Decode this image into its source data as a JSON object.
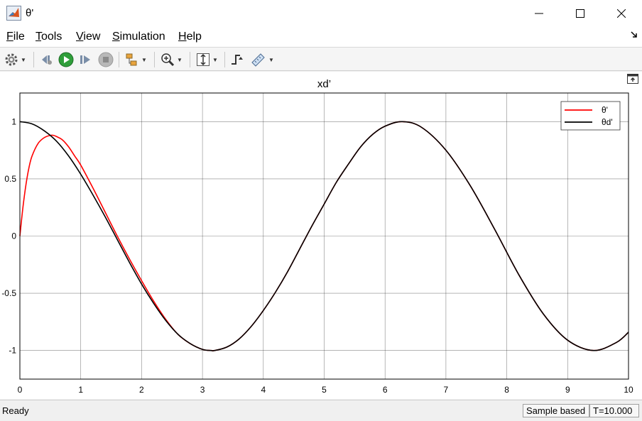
{
  "window": {
    "title": "θ'"
  },
  "menu": {
    "items": [
      {
        "label": "File",
        "underline": "F",
        "rest": "ile"
      },
      {
        "label": "Tools",
        "underline": "T",
        "rest": "ools"
      },
      {
        "label": "View",
        "underline": "V",
        "rest": "iew"
      },
      {
        "label": "Simulation",
        "underline": "S",
        "rest": "imulation"
      },
      {
        "label": "Help",
        "underline": "H",
        "rest": "elp"
      }
    ]
  },
  "toolbar": {
    "icons": [
      "gear-icon",
      "step-back-icon",
      "run-icon",
      "step-forward-icon",
      "stop-icon",
      "signal-select-icon",
      "zoom-icon",
      "fit-icon",
      "trigger-icon",
      "measure-icon"
    ]
  },
  "status": {
    "ready": "Ready",
    "sample": "Sample based",
    "time": "T=10.000"
  },
  "colors": {
    "series1": "#ff0000",
    "series2": "#000000",
    "grid": "#000000",
    "background": "#ffffff"
  },
  "chart_data": {
    "type": "line",
    "title": "xd’",
    "xlabel": "",
    "ylabel": "",
    "xlim": [
      0,
      10
    ],
    "ylim": [
      -1.25,
      1.25
    ],
    "xticks": [
      0,
      1,
      2,
      3,
      4,
      5,
      6,
      7,
      8,
      9,
      10
    ],
    "yticks": [
      1,
      0.5,
      0,
      -0.5,
      -1
    ],
    "ytick_labels": [
      "1",
      "0.5",
      "0",
      "-0.5",
      "-1"
    ],
    "grid": true,
    "legend": "top-right",
    "series": [
      {
        "name": "θ'",
        "color": "#ff0000",
        "x": [
          0,
          0.05,
          0.1,
          0.15,
          0.2,
          0.3,
          0.4,
          0.5,
          0.55,
          0.6,
          0.7,
          0.8,
          0.9,
          1.0,
          1.2,
          1.4,
          1.6,
          1.8,
          2.0,
          2.2,
          2.4,
          2.6,
          2.8,
          3.0,
          3.1416,
          3.2,
          3.4,
          3.6,
          3.8,
          4.0,
          4.2,
          4.4,
          4.6,
          4.8,
          5.0,
          5.2,
          5.4,
          5.6,
          5.8,
          6.0,
          6.2832,
          6.6,
          7.0,
          7.4,
          7.8,
          8.2,
          8.6,
          9.0,
          9.4248,
          9.8,
          10
        ],
        "y": [
          0,
          0.25,
          0.45,
          0.6,
          0.7,
          0.81,
          0.86,
          0.88,
          0.88,
          0.87,
          0.84,
          0.78,
          0.7,
          0.62,
          0.42,
          0.21,
          0.0,
          -0.2,
          -0.39,
          -0.57,
          -0.73,
          -0.86,
          -0.94,
          -0.99,
          -1.0,
          -1.0,
          -0.97,
          -0.9,
          -0.79,
          -0.65,
          -0.49,
          -0.31,
          -0.11,
          0.09,
          0.28,
          0.47,
          0.63,
          0.78,
          0.89,
          0.96,
          1.0,
          0.95,
          0.75,
          0.44,
          0.06,
          -0.34,
          -0.68,
          -0.91,
          -1.0,
          -0.93,
          -0.84
        ]
      },
      {
        "name": "θd'",
        "color": "#000000",
        "x": [
          0,
          0.2,
          0.4,
          0.6,
          0.8,
          1.0,
          1.2,
          1.4,
          1.6,
          1.8,
          2.0,
          2.2,
          2.4,
          2.6,
          2.8,
          3.0,
          3.1416,
          3.2,
          3.4,
          3.6,
          3.8,
          4.0,
          4.2,
          4.4,
          4.6,
          4.8,
          5.0,
          5.2,
          5.4,
          5.6,
          5.8,
          6.0,
          6.2832,
          6.6,
          7.0,
          7.4,
          7.8,
          8.2,
          8.6,
          9.0,
          9.4248,
          9.8,
          10
        ],
        "y": [
          1.0,
          0.98,
          0.92,
          0.83,
          0.7,
          0.54,
          0.36,
          0.17,
          -0.03,
          -0.23,
          -0.42,
          -0.59,
          -0.74,
          -0.86,
          -0.94,
          -0.99,
          -1.0,
          -1.0,
          -0.97,
          -0.9,
          -0.79,
          -0.65,
          -0.49,
          -0.31,
          -0.11,
          0.09,
          0.28,
          0.47,
          0.63,
          0.78,
          0.89,
          0.96,
          1.0,
          0.95,
          0.75,
          0.44,
          0.06,
          -0.34,
          -0.68,
          -0.91,
          -1.0,
          -0.93,
          -0.84
        ]
      }
    ]
  }
}
